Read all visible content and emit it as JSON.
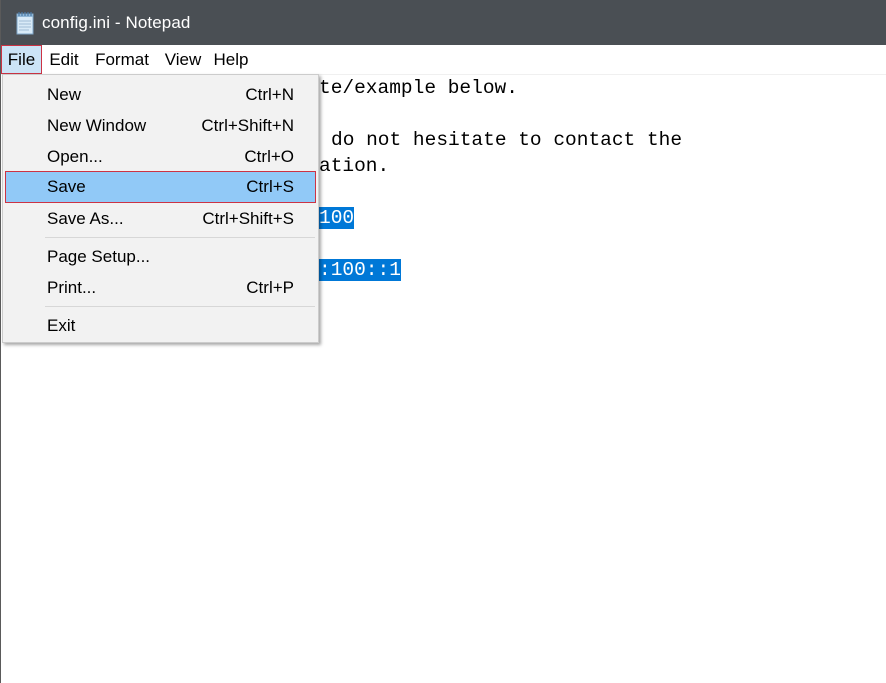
{
  "window": {
    "title": "config.ini - Notepad",
    "app_icon": "notepad-icon"
  },
  "menubar": {
    "items": [
      {
        "label": "File"
      },
      {
        "label": "Edit"
      },
      {
        "label": "Format"
      },
      {
        "label": "View"
      },
      {
        "label": "Help"
      }
    ]
  },
  "editor": {
    "visible_fragments": [
      {
        "text": "te/example below.",
        "selected": false
      },
      {
        "text": "do not hesitate to contact the",
        "selected": false
      },
      {
        "text": "ation.",
        "selected": false
      },
      {
        "text": "100",
        "selected": true
      },
      {
        "text": ":100::1",
        "selected": true
      }
    ]
  },
  "file_menu": {
    "items": [
      {
        "label": "New",
        "shortcut": "Ctrl+N"
      },
      {
        "label": "New Window",
        "shortcut": "Ctrl+Shift+N"
      },
      {
        "label": "Open...",
        "shortcut": "Ctrl+O"
      },
      {
        "label": "Save",
        "shortcut": "Ctrl+S",
        "highlighted": true
      },
      {
        "label": "Save As...",
        "shortcut": "Ctrl+Shift+S"
      },
      {
        "label": "Page Setup...",
        "shortcut": ""
      },
      {
        "label": "Print...",
        "shortcut": "Ctrl+P"
      },
      {
        "label": "Exit",
        "shortcut": ""
      }
    ]
  },
  "colors": {
    "titlebar": "#4a4f54",
    "selection": "#0078d7",
    "menu_highlight": "#91c9f7",
    "focus_border": "#cc3344"
  }
}
